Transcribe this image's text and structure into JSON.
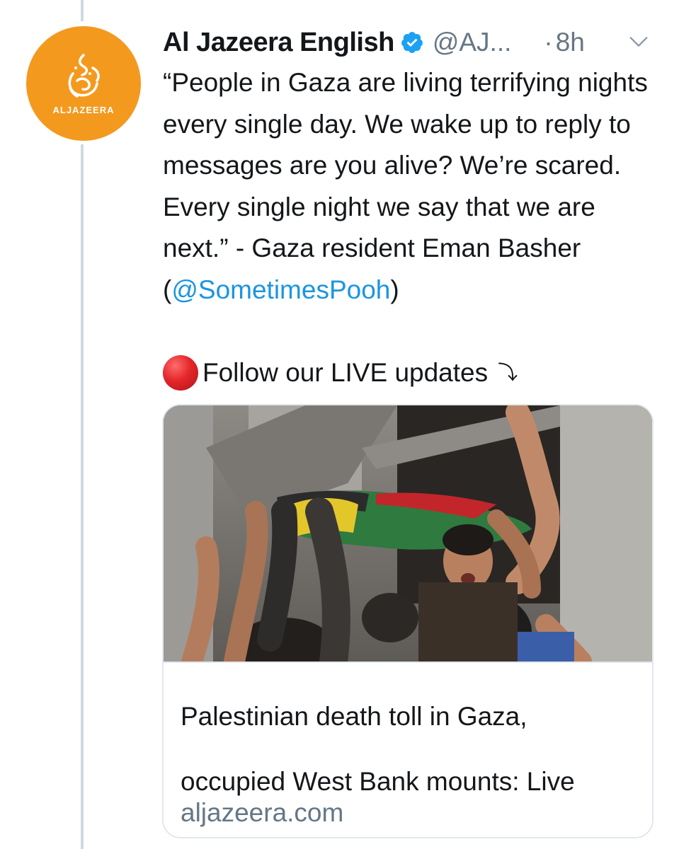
{
  "account": {
    "display_name": "Al Jazeera English",
    "handle": "@AJ...",
    "separator": "·",
    "timestamp": "8h",
    "avatar_label": "ALJAZEERA",
    "avatar_color": "#f39a1e",
    "verified_color": "#1da1f2"
  },
  "tweet": {
    "text_before_mention": "“People in Gaza are living terrifying nights every single day. We wake up to reply to messages are you alive? We’re scared. Every single night we say that we are next.” - Gaza resident Eman Basher (",
    "mention": "@SometimesPooh",
    "text_after_mention": ")",
    "live_label": "Follow our LIVE updates",
    "live_arrow": "⤵"
  },
  "link_card": {
    "title_line1": "Palestinian death toll in Gaza,",
    "title_line2": "occupied West Bank mounts: Live",
    "domain": "aljazeera.com",
    "image_alt": "funeral-crowd-photo"
  },
  "colors": {
    "link": "#1b95e0",
    "secondary_text": "#657786",
    "thread_line": "#cfd9de",
    "card_border": "#e1e8ed"
  },
  "icons": {
    "verified": "verified-badge-icon",
    "chevron": "chevron-down-icon",
    "live_dot": "red-circle-icon"
  }
}
